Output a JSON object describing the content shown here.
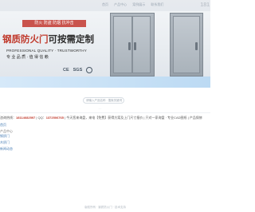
{
  "banner": {
    "nav_items": [
      "首页",
      "产品中心",
      "案例展示",
      "联系我们"
    ],
    "corner_text": "181",
    "tagline": "防火 防盗 防烟 抗冲击",
    "headline_red": "钢质防火门",
    "headline_dark": "可按需定制",
    "english_line": "PROFESSIONAL QUALITY · TRUSTWORTHY",
    "cn_sub": "专 业 品 质 · 值 得 信 赖",
    "certs": [
      "CE",
      "SGS"
    ]
  },
  "search": {
    "placeholder": "请输入产品名称 · 搜索关键词"
  },
  "small_center_text": "· ·",
  "contact": {
    "prefix": "咨询热线：",
    "phone": "18114682597",
    "qq_label": " | QQ：",
    "qq": "1372506765",
    "rest": " | 今天您来询盘，来电【免费】获得方案及上门尺寸报价 | 只对一家询盘 · 专业CAD图纸 | 产品保修"
  },
  "left_links": [
    {
      "label": "首页",
      "style": "blue"
    },
    {
      "label": "产品中心",
      "style": "gray"
    }
  ],
  "side_list": [
    "钢质门",
    "木质门",
    "新闻动态"
  ],
  "footer": "版权所有 · 钢质防火门 · 技术支持"
}
